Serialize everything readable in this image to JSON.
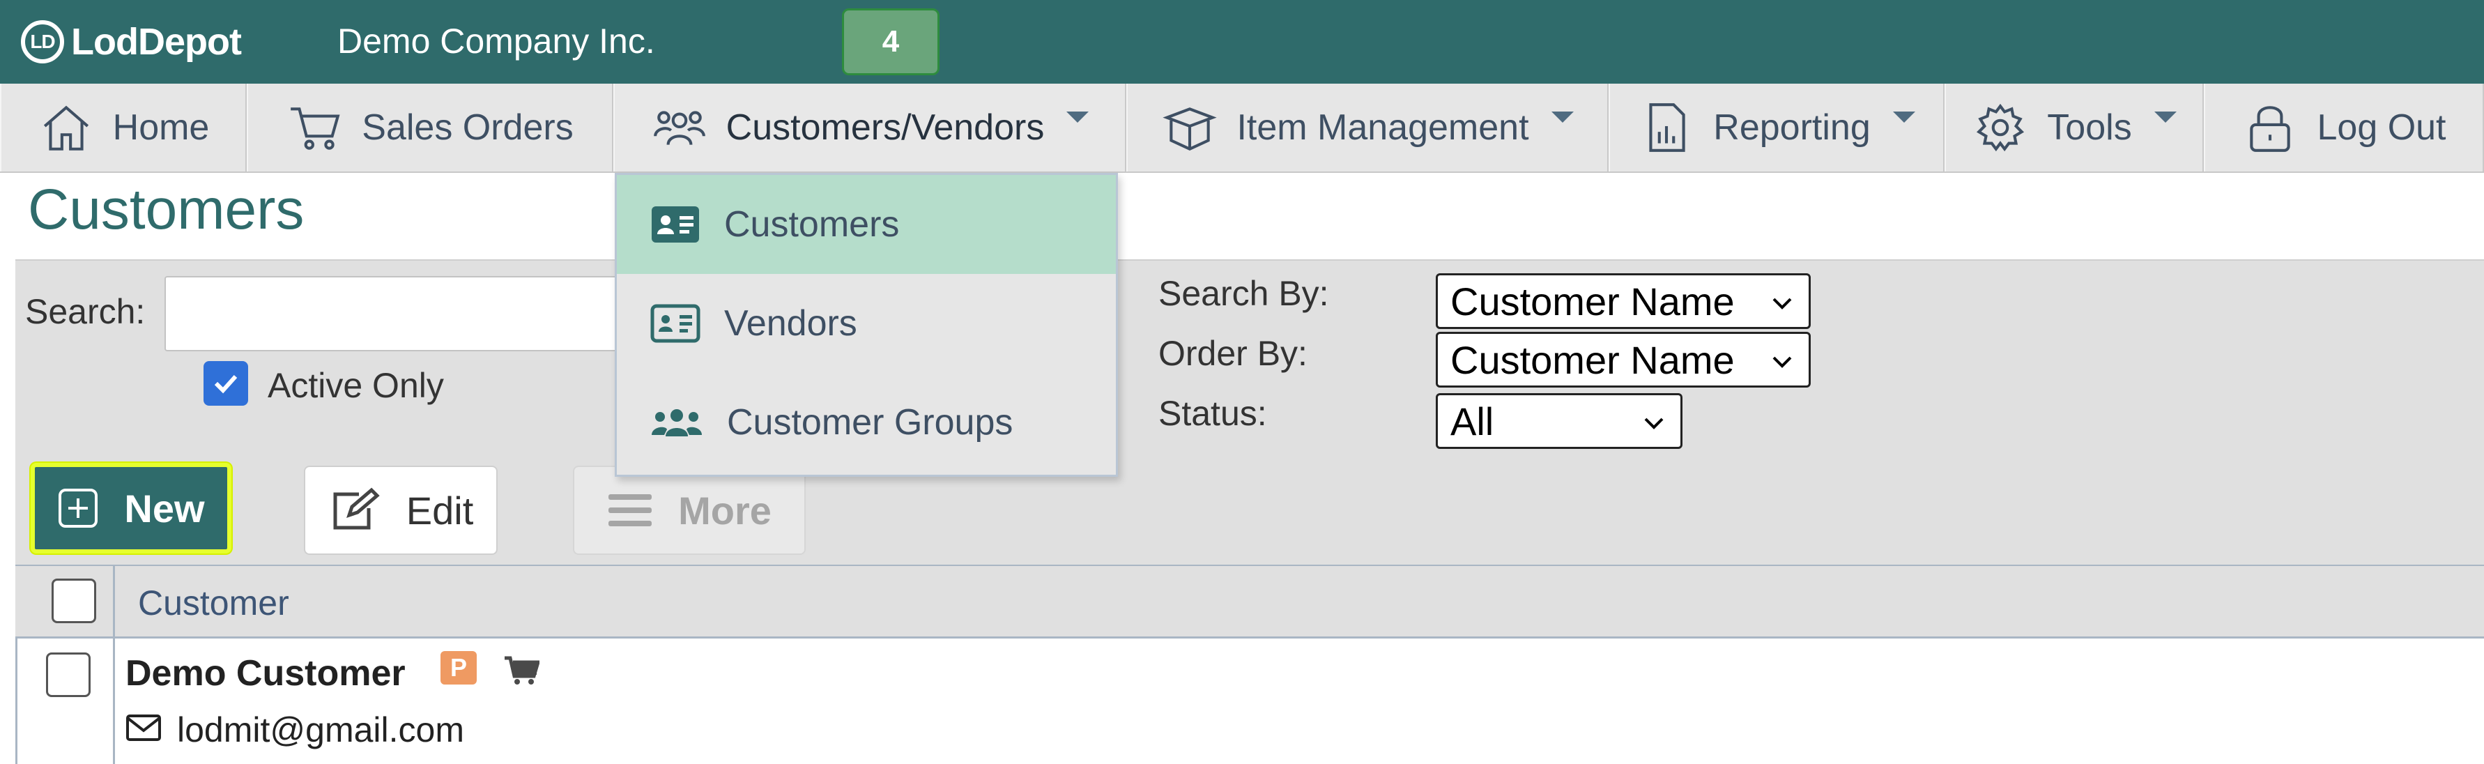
{
  "app": {
    "logo_text": "LodDepot",
    "logo_mark": "LD",
    "company": "Demo Company Inc.",
    "notification_count": "4"
  },
  "nav": {
    "items": [
      {
        "label": "Home",
        "icon": "home-icon"
      },
      {
        "label": "Sales Orders",
        "icon": "cart-icon"
      },
      {
        "label": "Customers/Vendors",
        "icon": "users-icon",
        "has_caret": true
      },
      {
        "label": "Item Management",
        "icon": "box-icon",
        "has_caret": true
      },
      {
        "label": "Reporting",
        "icon": "report-icon",
        "has_caret": true
      },
      {
        "label": "Tools",
        "icon": "gear-icon",
        "has_caret": true
      },
      {
        "label": "Log Out",
        "icon": "lock-icon"
      }
    ]
  },
  "dropdown": {
    "items": [
      {
        "label": "Customers",
        "icon": "id-card-icon",
        "selected": true
      },
      {
        "label": "Vendors",
        "icon": "id-card-outline-icon"
      },
      {
        "label": "Customer Groups",
        "icon": "group-icon"
      }
    ]
  },
  "page": {
    "title": "Customers"
  },
  "filters": {
    "search_label": "Search:",
    "search_value": "",
    "active_only_label": "Active Only",
    "active_only_checked": true,
    "search_by_label": "Search By:",
    "search_by_value": "Customer Name",
    "order_by_label": "Order By:",
    "order_by_value": "Customer Name",
    "status_label": "Status:",
    "status_value": "All"
  },
  "toolbar": {
    "new_label": "New",
    "edit_label": "Edit",
    "more_label": "More"
  },
  "table": {
    "columns": [
      "Customer"
    ],
    "rows": [
      {
        "name": "Demo Customer",
        "badge": "P",
        "email": "lodmit@gmail.com"
      }
    ]
  },
  "colors": {
    "brand": "#2f6b6b",
    "selected_menu": "#b5ddcb",
    "badge_orange": "#ef9a62",
    "highlight": "#e6ff2e"
  }
}
